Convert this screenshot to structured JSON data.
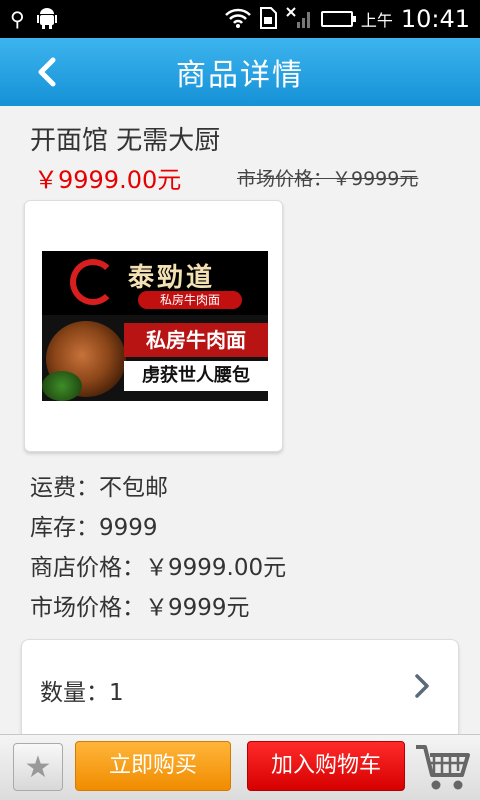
{
  "statusbar": {
    "ampm": "上午",
    "time": "10:41",
    "battery_level": 1.0
  },
  "header": {
    "title": "商品详情"
  },
  "product": {
    "name": "开面馆 无需大厨",
    "price": "￥9999.00元",
    "market_price": "市场价格：￥9999元",
    "banner": {
      "brand": "泰勁道",
      "brand_sub": "私房牛肉面",
      "slogan_1": "私房牛肉面",
      "slogan_2": "虏获世人腰包"
    },
    "freight": "运费：不包邮",
    "stock": "库存：9999",
    "store_price": "商店价格：￥9999.00元",
    "market_price_2": "市场价格：￥9999元",
    "quantity": "数量：1"
  },
  "bottombar": {
    "buy_now_label": "立即购买",
    "add_to_cart_label": "加入购物车"
  },
  "colors": {
    "header": "#1ca0e3",
    "price_red": "#e60000",
    "buy_orange": "#f7a21b",
    "cart_red": "#e80000"
  }
}
